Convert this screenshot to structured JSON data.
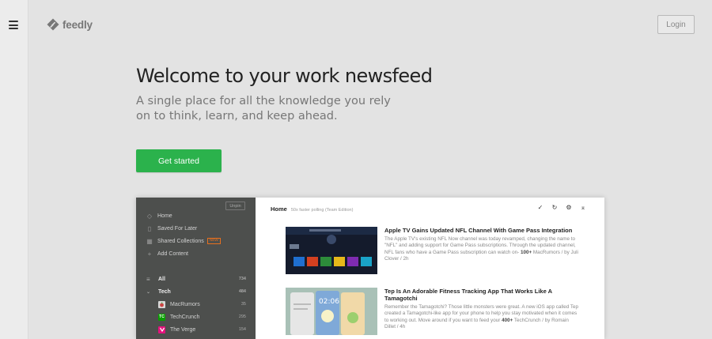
{
  "app": {
    "logo_text": "feedly",
    "login_label": "Login"
  },
  "hero": {
    "title": "Welcome to your work newsfeed",
    "subtitle": "A single place for all the knowledge you rely on to think, learn, and keep ahead.",
    "cta_label": "Get started"
  },
  "preview": {
    "sidebar": {
      "unpin_label": "Unpin",
      "nav": [
        {
          "label": "Home",
          "icon": "home-icon"
        },
        {
          "label": "Saved For Later",
          "icon": "bookmark-icon"
        },
        {
          "label": "Shared Collections",
          "icon": "grid-icon",
          "badge": "NEW"
        },
        {
          "label": "Add Content",
          "icon": "plus-icon"
        }
      ],
      "feeds": [
        {
          "label": "All",
          "count": "734",
          "icon": "list-icon"
        },
        {
          "label": "Tech",
          "count": "484",
          "icon": "chevron-down-icon"
        },
        {
          "label": "MacRumors",
          "count": "35",
          "icon": "macrumors-favicon"
        },
        {
          "label": "TechCrunch",
          "count": "295",
          "icon": "techcrunch-favicon",
          "abbr": "TC"
        },
        {
          "label": "The Verge",
          "count": "154",
          "icon": "verge-favicon"
        }
      ]
    },
    "header": {
      "title": "Home",
      "subtitle": "50x faster polling (Team Edition)"
    },
    "articles": [
      {
        "title": "Apple TV Gains Updated NFL Channel With Game Pass Integration",
        "summary": "The Apple TV's existing NFL Now channel was today revamped, changing the name to \"NFL\" and adding support for Game Pass subscriptions. Through the updated channel, NFL fans who have a Game Pass subscription can watch on-",
        "count": "100+",
        "meta": "MacRumors / by Juli Clover / 2h"
      },
      {
        "title": "Tep Is An Adorable Fitness Tracking App That Works Like A Tamagotchi",
        "summary": "Remember the Tamagotchi? Those little monsters were great. A new iOS app called Tep created a Tamagotchi-like app for your phone to help you stay motivated when it comes to working out. Move around if you want to feed your",
        "count": "400+",
        "meta": "TechCrunch / by Romain Dillet / 4h",
        "time_display": "02:06"
      }
    ]
  },
  "colors": {
    "accent_green": "#2bb24c",
    "sidebar_bg": "#4d4f4d",
    "page_bg": "#e3e3e3"
  }
}
